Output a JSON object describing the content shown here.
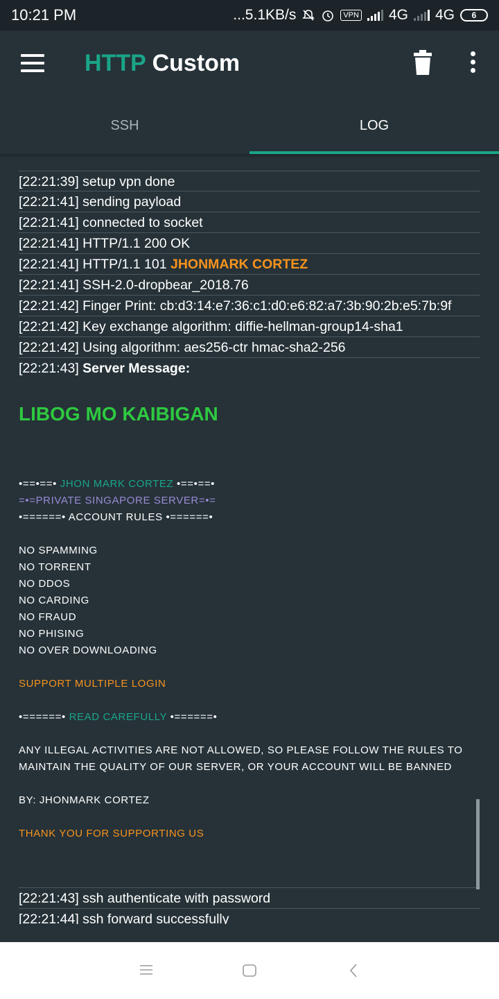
{
  "status_bar": {
    "time": "10:21 PM",
    "speed": "...5.1KB/s",
    "vpn": "VPN",
    "network1": "4G",
    "network2": "4G",
    "battery": "6"
  },
  "app_bar": {
    "title_part1": "HTTP",
    "title_part2": "Custom"
  },
  "tabs": [
    {
      "label": "SSH",
      "active": false
    },
    {
      "label": "LOG",
      "active": true
    }
  ],
  "log": {
    "lines": [
      "[22:21:39] setup vpn done",
      "[22:21:41] sending payload",
      "[22:21:41] connected to socket",
      "[22:21:41] HTTP/1.1 200 OK"
    ],
    "line_http101_prefix": "[22:21:41] HTTP/1.1 101 ",
    "line_http101_name": "JHONMARK CORTEZ",
    "lines2": [
      "[22:21:41] SSH-2.0-dropbear_2018.76",
      "[22:21:42] Finger Print: cb:d3:14:e7:36:c1:d0:e6:82:a7:3b:90:2b:e5:7b:9f",
      "[22:21:42] Key exchange algorithm: diffie-hellman-group14-sha1",
      "[22:21:42] Using algorithm: aes256-ctr hmac-sha2-256"
    ],
    "server_msg_prefix": "[22:21:43] ",
    "server_msg_label": "Server Message:",
    "banner": "LIBOG MO KAIBIGAN",
    "msg": {
      "header1_left": "•==•==• ",
      "header1_name": "JHON MARK CORTEZ",
      "header1_right": " •==•==•",
      "header2": "=•=PRIVATE SINGAPORE SERVER=•=",
      "header3": "•======• ACCOUNT RULES •======•",
      "rules": [
        "NO SPAMMING",
        "NO TORRENT",
        "NO DDOS",
        "NO CARDING",
        "NO FRAUD",
        "NO PHISING",
        "NO OVER DOWNLOADING"
      ],
      "support": "SUPPORT MULTIPLE LOGIN",
      "read_left": "•======• ",
      "read_mid": "READ CAREFULLY",
      "read_right": " •======•",
      "warning_line1": "ANY ILLEGAL ACTIVITIES ARE NOT ALLOWED, SO PLEASE FOLLOW THE RULES TO",
      "warning_line2": "MAINTAIN THE QUALITY OF OUR SERVER, OR YOUR ACCOUNT WILL BE BANNED",
      "by": "BY: JHONMARK CORTEZ",
      "thanks": "THANK YOU FOR SUPPORTING US"
    },
    "tail": [
      "[22:21:43] ssh authenticate with password",
      "[22:21:44] ssh forward successfully"
    ]
  },
  "colors": {
    "accent": "#1aa589",
    "background": "#263238",
    "orange": "#f7931e",
    "green_banner": "#2ec940",
    "purple": "#9b8bd6"
  },
  "icons": {
    "menu": "hamburger-menu-icon",
    "trash": "trash-icon",
    "more": "more-vertical-icon",
    "nav_recents": "recents-icon",
    "nav_home": "home-icon",
    "nav_back": "back-icon"
  }
}
